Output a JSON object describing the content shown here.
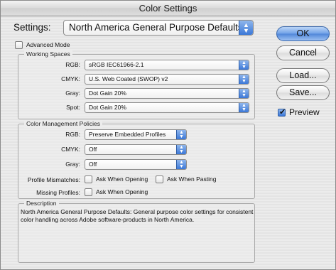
{
  "window": {
    "title": "Color Settings"
  },
  "settings": {
    "label": "Settings:",
    "value": "North America General Purpose Defaults",
    "advanced_mode_label": "Advanced Mode",
    "advanced_mode_checked": false
  },
  "working_spaces": {
    "title": "Working Spaces",
    "rows": [
      {
        "label": "RGB:",
        "value": "sRGB IEC61966-2.1"
      },
      {
        "label": "CMYK:",
        "value": "U.S. Web Coated (SWOP) v2"
      },
      {
        "label": "Gray:",
        "value": "Dot Gain 20%"
      },
      {
        "label": "Spot:",
        "value": "Dot Gain 20%"
      }
    ]
  },
  "policies": {
    "title": "Color Management Policies",
    "rows": [
      {
        "label": "RGB:",
        "value": "Preserve Embedded Profiles"
      },
      {
        "label": "CMYK:",
        "value": "Off"
      },
      {
        "label": "Gray:",
        "value": "Off"
      }
    ],
    "profile_mismatches_label": "Profile Mismatches:",
    "ask_when_opening_label": "Ask When Opening",
    "ask_when_pasting_label": "Ask When Pasting",
    "missing_profiles_label": "Missing Profiles:",
    "missing_ask_when_opening_label": "Ask When Opening"
  },
  "description": {
    "title": "Description",
    "text": "North America General Purpose Defaults:  General purpose color settings for consistent color handling across Adobe software-products in North America."
  },
  "buttons": {
    "ok": "OK",
    "cancel": "Cancel",
    "load": "Load...",
    "save": "Save...",
    "preview_label": "Preview",
    "preview_checked": true
  },
  "colors": {
    "accent": "#3b78d8",
    "window_bg": "#ececec"
  }
}
